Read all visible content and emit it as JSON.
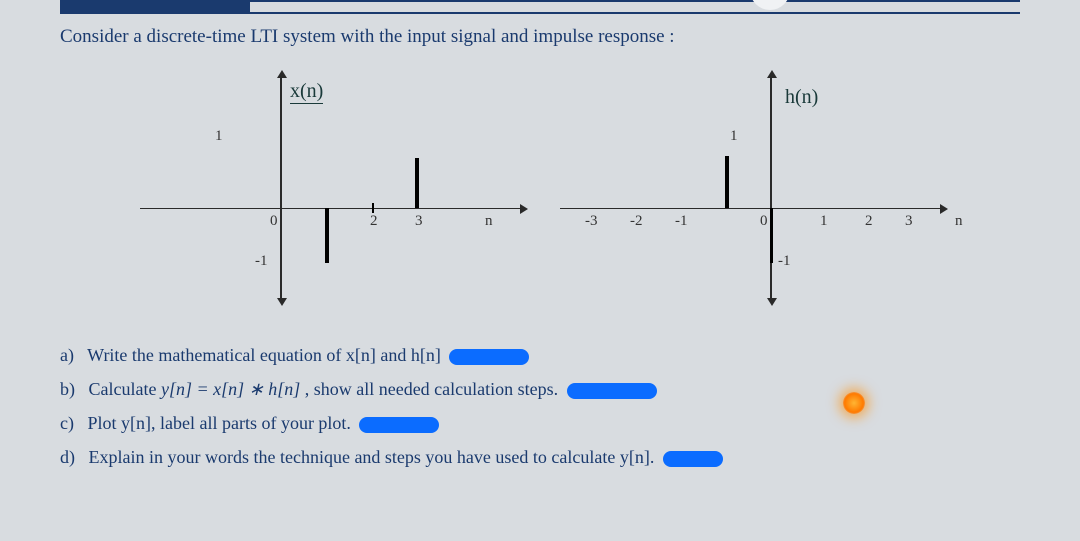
{
  "header": {
    "prompt": "Consider a discrete-time LTI system with the input signal  and impulse response :"
  },
  "graph_x": {
    "fn_label": "x(n)",
    "y_top": "1",
    "y_bot": "-1",
    "ticks": {
      "t0": "0",
      "t2": "2",
      "t3": "3",
      "tn": "n"
    }
  },
  "graph_h": {
    "fn_label": "h(n)",
    "y_top": "1",
    "y_bot": "-1",
    "ticks": {
      "tm3": "-3",
      "tm2": "-2",
      "tm1": "-1",
      "t0": "0",
      "t1": "1",
      "t2": "2",
      "t3": "3",
      "tn": "n"
    }
  },
  "questions": {
    "a_prefix": "a)",
    "a_text": "Write the mathematical equation of x[n] and h[n]",
    "b_prefix": "b)",
    "b_text1": "Calculate ",
    "b_eq": "y[n] = x[n] ∗ h[n]",
    "b_text2": " , show all needed calculation steps.",
    "c_prefix": "c)",
    "c_text": "Plot y[n], label all parts of your plot.",
    "d_prefix": "d)",
    "d_text": "Explain in your words the technique and steps you have used to calculate y[n]."
  },
  "chart_data": [
    {
      "type": "stem",
      "name": "x(n)",
      "x": [
        1,
        3
      ],
      "y": [
        -1,
        1
      ],
      "xlabel": "n",
      "ylim": [
        -1.5,
        1.5
      ]
    },
    {
      "type": "stem",
      "name": "h(n)",
      "x": [
        -1,
        0
      ],
      "y": [
        1,
        -1
      ],
      "xlabel": "n",
      "ylim": [
        -1.5,
        1.5
      ]
    }
  ]
}
